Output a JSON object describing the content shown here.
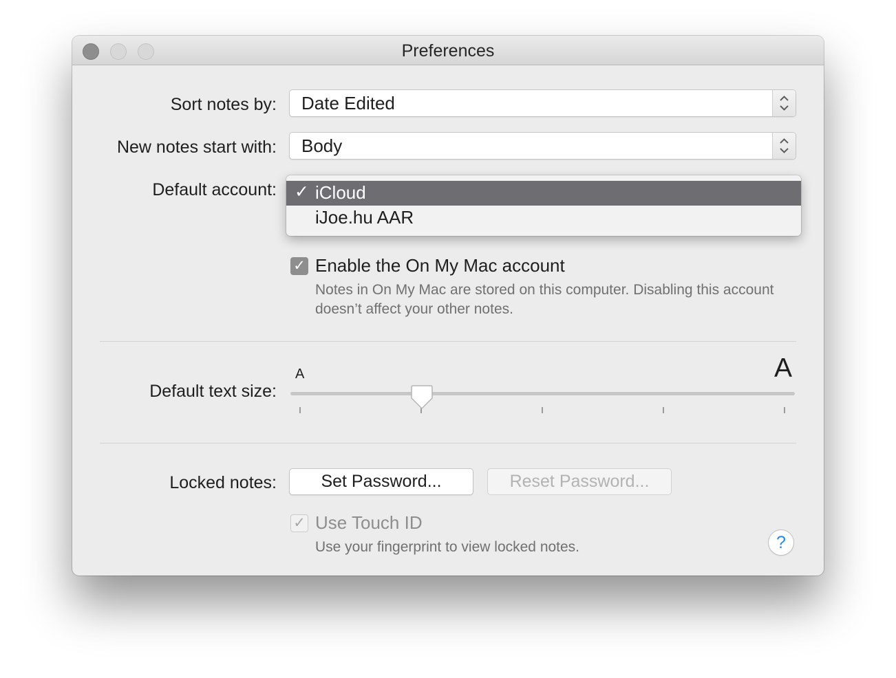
{
  "window": {
    "title": "Preferences"
  },
  "sort": {
    "label": "Sort notes by:",
    "value": "Date Edited"
  },
  "new_notes": {
    "label": "New notes start with:",
    "value": "Body"
  },
  "default_account": {
    "label": "Default account:",
    "options": [
      {
        "check": "✓",
        "label": "iCloud",
        "selected": true
      },
      {
        "label": "iJoe.hu AAR",
        "selected": false
      }
    ]
  },
  "on_my_mac": {
    "checked": true,
    "check_glyph": "✓",
    "label": "Enable the On My Mac account",
    "description": "Notes in On My Mac are stored on this computer. Disabling this account doesn’t affect your other notes."
  },
  "text_size": {
    "label": "Default text size:",
    "small_glyph": "A",
    "large_glyph": "A",
    "ticks": 5,
    "selected_index": 1
  },
  "locked_notes": {
    "label": "Locked notes:",
    "set_password": "Set Password...",
    "reset_password": "Reset Password...",
    "touch_id": {
      "checked": true,
      "enabled": false,
      "check_glyph": "✓",
      "label": "Use Touch ID",
      "description": "Use your fingerprint to view locked notes."
    }
  },
  "help": {
    "glyph": "?"
  },
  "colors": {
    "menu_highlight": "#6d6d72",
    "help_accent": "#2a86e8",
    "window_background": "#ececec"
  }
}
